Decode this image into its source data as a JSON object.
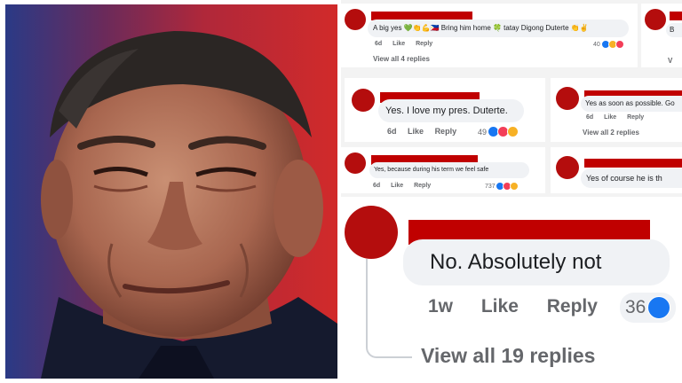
{
  "photo": {
    "alt": "portrait-photo"
  },
  "comments": [
    {
      "text": "A big yes 💚👏💪🇵🇭 Bring him home 🍀 tatay Digong Duterte 👏✌",
      "time": "6d",
      "like": "Like",
      "reply": "Reply",
      "count": "40",
      "view": "View all 4 replies"
    },
    {
      "text": "B",
      "view": "V"
    },
    {
      "text": "Yes. I love my pres. Duterte.",
      "time": "6d",
      "like": "Like",
      "reply": "Reply",
      "count": "49"
    },
    {
      "text": "Yes as soon as possible. Go",
      "time": "6d",
      "like": "Like",
      "reply": "Reply",
      "view": "View all 2 replies"
    },
    {
      "text": "Yes, because during his term we feel safe",
      "time": "6d",
      "like": "Like",
      "reply": "Reply",
      "count": "737"
    },
    {
      "text": "Yes of course he is th"
    },
    {
      "text": "No. Absolutely not",
      "time": "1w",
      "like": "Like",
      "reply": "Reply",
      "count": "36",
      "view": "View all 19 replies"
    }
  ],
  "colors": {
    "redaction": "#c00000",
    "avatar": "#b40d0d",
    "bubble": "#f0f2f5",
    "meta": "#65676b"
  }
}
